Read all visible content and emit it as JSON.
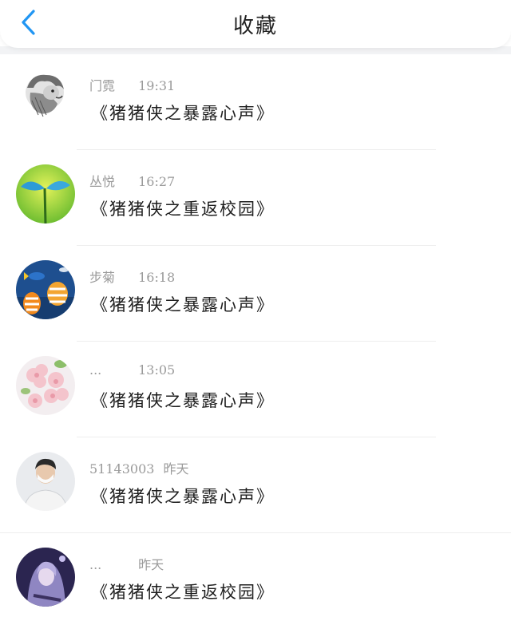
{
  "header": {
    "title": "收藏",
    "back_icon": "chevron-left-icon",
    "accent_color": "#2196F3"
  },
  "items": [
    {
      "name": "门霓",
      "time": "19:31",
      "title": "《猪猪侠之暴露心声》",
      "avatar": "lion-avatar"
    },
    {
      "name": "丛悦",
      "time": "16:27",
      "title": "《猪猪侠之重返校园》",
      "avatar": "sprout-avatar"
    },
    {
      "name": "步菊",
      "time": "16:18",
      "title": "《猪猪侠之暴露心声》",
      "avatar": "fish-avatar"
    },
    {
      "name": "...",
      "time": "13:05",
      "title": "《猪猪侠之暴露心声》",
      "avatar": "flowers-avatar"
    },
    {
      "name": "51143003",
      "time": "昨天",
      "title": "《猪猪侠之暴露心声》",
      "avatar": "person-avatar"
    },
    {
      "name": "...",
      "time": "昨天",
      "title": "《猪猪侠之重返校园》",
      "avatar": "anime-avatar"
    }
  ]
}
